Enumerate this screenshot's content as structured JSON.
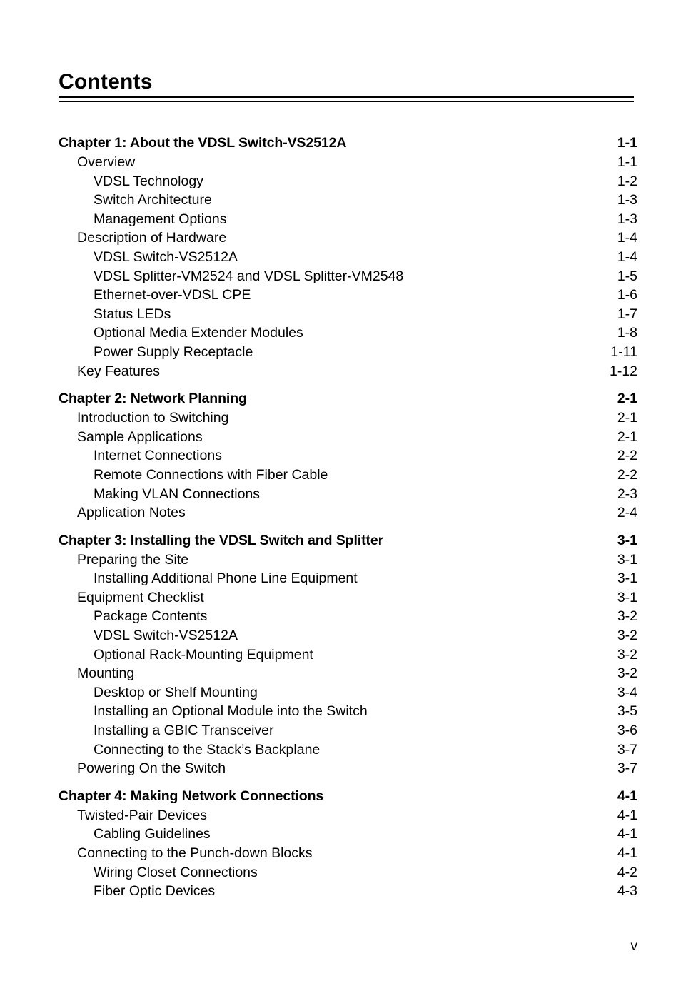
{
  "document": {
    "heading": "Contents",
    "folio": "v"
  },
  "toc": {
    "entries": [
      {
        "level": "chapter",
        "label": "Chapter 1: About the VDSL Switch-VS2512A",
        "page": "1-1"
      },
      {
        "level": "1",
        "label": "Overview",
        "page": "1-1"
      },
      {
        "level": "2",
        "label": "VDSL Technology",
        "page": "1-2"
      },
      {
        "level": "2",
        "label": "Switch Architecture",
        "page": "1-3"
      },
      {
        "level": "2",
        "label": "Management Options",
        "page": "1-3"
      },
      {
        "level": "1",
        "label": "Description of Hardware",
        "page": "1-4"
      },
      {
        "level": "2",
        "label": "VDSL Switch-VS2512A",
        "page": "1-4"
      },
      {
        "level": "2",
        "label": "VDSL Splitter-VM2524 and VDSL Splitter-VM2548",
        "page": "1-5"
      },
      {
        "level": "2",
        "label": "Ethernet-over-VDSL CPE",
        "page": "1-6"
      },
      {
        "level": "2",
        "label": "Status LEDs",
        "page": "1-7"
      },
      {
        "level": "2",
        "label": "Optional Media Extender Modules",
        "page": "1-8"
      },
      {
        "level": "2",
        "label": "Power Supply Receptacle",
        "page": "1-11"
      },
      {
        "level": "1",
        "label": "Key Features",
        "page": "1-12"
      },
      {
        "level": "chapter",
        "label": "Chapter 2: Network Planning",
        "page": "2-1"
      },
      {
        "level": "1",
        "label": "Introduction to Switching",
        "page": "2-1"
      },
      {
        "level": "1",
        "label": "Sample Applications",
        "page": "2-1"
      },
      {
        "level": "2",
        "label": "Internet Connections",
        "page": "2-2"
      },
      {
        "level": "2",
        "label": "Remote Connections with Fiber Cable",
        "page": "2-2"
      },
      {
        "level": "2",
        "label": "Making VLAN Connections",
        "page": "2-3"
      },
      {
        "level": "1",
        "label": "Application Notes",
        "page": "2-4"
      },
      {
        "level": "chapter",
        "label": "Chapter 3: Installing the VDSL Switch and Splitter",
        "page": "3-1"
      },
      {
        "level": "1",
        "label": "Preparing the Site",
        "page": "3-1"
      },
      {
        "level": "2",
        "label": "Installing Additional Phone Line Equipment",
        "page": "3-1"
      },
      {
        "level": "1",
        "label": "Equipment Checklist",
        "page": "3-1"
      },
      {
        "level": "2",
        "label": "Package Contents",
        "page": "3-2"
      },
      {
        "level": "2",
        "label": "VDSL Switch-VS2512A",
        "page": "3-2"
      },
      {
        "level": "2",
        "label": "Optional Rack-Mounting Equipment",
        "page": "3-2"
      },
      {
        "level": "1",
        "label": "Mounting",
        "page": "3-2"
      },
      {
        "level": "2",
        "label": "Desktop or Shelf Mounting",
        "page": "3-4"
      },
      {
        "level": "2",
        "label": "Installing an Optional Module into the Switch",
        "page": "3-5"
      },
      {
        "level": "2",
        "label": "Installing a GBIC Transceiver",
        "page": "3-6"
      },
      {
        "level": "2",
        "label": "Connecting to the Stack’s Backplane",
        "page": "3-7"
      },
      {
        "level": "1",
        "label": "Powering On the Switch",
        "page": "3-7"
      },
      {
        "level": "chapter",
        "label": "Chapter 4: Making Network Connections",
        "page": "4-1"
      },
      {
        "level": "1",
        "label": "Twisted-Pair Devices",
        "page": "4-1"
      },
      {
        "level": "2",
        "label": "Cabling Guidelines",
        "page": "4-1"
      },
      {
        "level": "1",
        "label": "Connecting to the Punch-down Blocks",
        "page": "4-1"
      },
      {
        "level": "2",
        "label": "Wiring Closet Connections",
        "page": "4-2"
      },
      {
        "level": "2",
        "label": "Fiber Optic Devices",
        "page": "4-3"
      }
    ]
  }
}
